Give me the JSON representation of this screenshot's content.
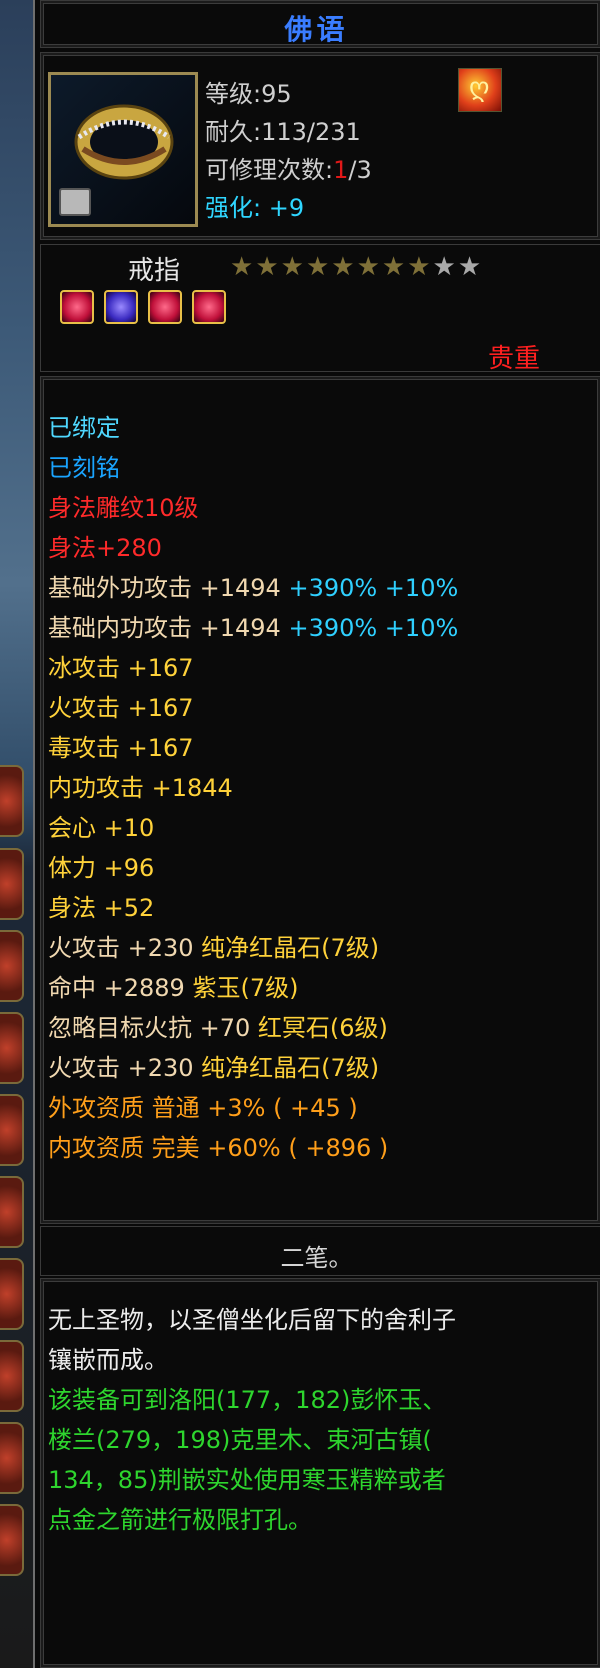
{
  "title": "佛语",
  "item": {
    "icon_name": "ring-icon",
    "level_label": "等级:95",
    "durability_label": "耐久:113/231",
    "repair_prefix": "可修理次数:",
    "repair_used": "1",
    "repair_suffix": "/3",
    "enhance_label": "强化: +9",
    "type": "戒指",
    "stars_filled": 8,
    "stars_total": 9,
    "gems": [
      "red-gem-icon",
      "purple-gem-icon",
      "red-gem-icon",
      "red-gem-icon"
    ],
    "rarity": "贵重"
  },
  "attributes": [
    {
      "text": "已绑定",
      "color": "c-cyan"
    },
    {
      "text": "已刻铭",
      "color": "c-blue"
    },
    {
      "text": "身法雕纹10级",
      "color": "c-red"
    },
    {
      "text": "身法+280",
      "color": "c-red"
    },
    {
      "text": "基础外功攻击 +1494",
      "extra": "+390% +10%",
      "color": "c-beige"
    },
    {
      "text": "基础内功攻击 +1494",
      "extra": "+390% +10%",
      "color": "c-beige"
    },
    {
      "text": "冰攻击 +167",
      "color": "c-yel"
    },
    {
      "text": "火攻击 +167",
      "color": "c-yel"
    },
    {
      "text": "毒攻击 +167",
      "color": "c-yel"
    },
    {
      "text": "内功攻击 +1844",
      "color": "c-yel"
    },
    {
      "text": "会心 +10",
      "color": "c-yel"
    },
    {
      "text": "体力 +96",
      "color": "c-yel"
    },
    {
      "text": "身法 +52",
      "color": "c-yel"
    },
    {
      "text": "火攻击 +230",
      "extra": "纯净红晶石(7级)",
      "color": "c-beige",
      "extra_color": "c-yel"
    },
    {
      "text": "命中 +2889",
      "extra": "紫玉(7级)",
      "color": "c-beige",
      "extra_color": "c-yel"
    },
    {
      "text": "忽略目标火抗 +70",
      "extra": "红冥石(6级)",
      "color": "c-beige",
      "extra_color": "c-yel"
    },
    {
      "text": "火攻击 +230",
      "extra": "纯净红晶石(7级)",
      "color": "c-beige",
      "extra_color": "c-yel"
    },
    {
      "text": "外攻资质  普通 +3% ( +45 )",
      "color": "c-orange"
    },
    {
      "text": "内攻资质  完美 +60% ( +896 )",
      "color": "c-orange"
    }
  ],
  "section_title": "二笔。",
  "description": [
    {
      "text": "无上圣物，以圣僧坐化后留下的舍利子",
      "color": "c-white"
    },
    {
      "text": "镶嵌而成。",
      "color": "c-white"
    },
    {
      "text": "该装备可到洛阳(177，182)彭怀玉、",
      "color": "c-green"
    },
    {
      "text": "楼兰(279，198)克里木、束河古镇(",
      "color": "c-green"
    },
    {
      "text": "134，85)荆嵌实处使用寒玉精粹或者",
      "color": "c-green"
    },
    {
      "text": "点金之箭进行极限打孔。",
      "color": "c-green"
    }
  ],
  "colors": {
    "title": "#3a7dff",
    "border_gold": "#9c8a52",
    "rarity_red": "#ff2020"
  }
}
